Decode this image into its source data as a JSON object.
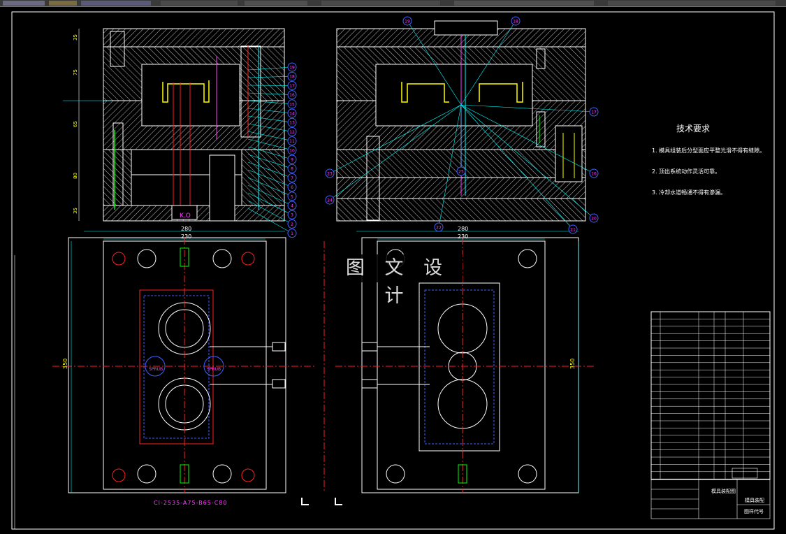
{
  "watermark": "图 文 设 计",
  "technical_requirements": {
    "title": "技术要求",
    "lines": [
      "1. 模具组装后分型面应平整光滑不得有缝隙。",
      "2. 顶出系统动作灵活可靠。",
      "3. 冷却水道畅通不得有渗漏。"
    ]
  },
  "dimensions": {
    "overall_width_left": "280",
    "inner_width_left": "230",
    "overall_width_right": "280",
    "inner_width_right": "230",
    "height_left": "350",
    "height_right": "350",
    "stack": [
      "35",
      "75",
      "65",
      "80",
      "35"
    ]
  },
  "part_code": "CI-2535-A75-B65-C80",
  "center_label": "K.O",
  "spr_labels": [
    "SPRUB",
    "SPRUB"
  ],
  "title_block": {
    "drawing_name": "模具装配图",
    "material_label": "模具装配",
    "drawing_no_label": "图样代号"
  },
  "balloons_left": [
    "19",
    "18",
    "17",
    "16",
    "15",
    "14",
    "13",
    "12",
    "11",
    "10",
    "9",
    "8",
    "7",
    "6",
    "5",
    "4",
    "3",
    "2",
    "1"
  ],
  "balloons_right": [
    "19",
    "18",
    "17",
    "16",
    "20",
    "21",
    "22",
    "23",
    "24",
    "25"
  ],
  "colors": {
    "background": "#000000",
    "line_white": "#ffffff",
    "hatch": "#bfbfbf",
    "red": "#ff2020",
    "cyan": "#00ffff",
    "magenta": "#ff3fff",
    "yellow": "#ffff00",
    "green": "#00ff00",
    "blue": "#4060ff"
  }
}
